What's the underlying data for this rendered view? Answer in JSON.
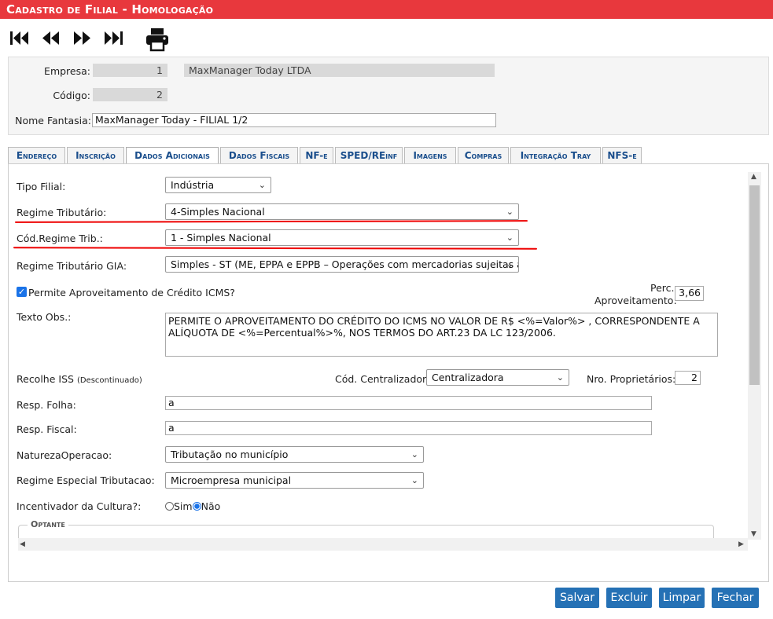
{
  "window": {
    "title": "Cadastro de Filial  - Homologação"
  },
  "toolbar": {
    "icons": [
      "first-record-icon",
      "previous-record-icon",
      "next-record-icon",
      "last-record-icon",
      "print-icon"
    ]
  },
  "header": {
    "empresa_label": "Empresa:",
    "empresa_code": "1",
    "empresa_name": "MaxManager Today LTDA",
    "codigo_label": "Código:",
    "codigo_value": "2",
    "nome_fantasia_label": "Nome Fantasia:",
    "nome_fantasia_value": "MaxManager Today - FILIAL 1/2"
  },
  "tabs": [
    {
      "label": "Endereço"
    },
    {
      "label": "Inscrição"
    },
    {
      "label": "Dados Adicionais"
    },
    {
      "label": "Dados Fiscais"
    },
    {
      "label": "NF-e"
    },
    {
      "label": "SPED/REinf"
    },
    {
      "label": "Imagens"
    },
    {
      "label": "Compras"
    },
    {
      "label": "Integração Tray"
    },
    {
      "label": "NFS-e"
    }
  ],
  "active_tab": "Dados Adicionais",
  "form": {
    "tipo_filial": {
      "label": "Tipo Filial:",
      "value": "Indústria"
    },
    "regime_tributario": {
      "label": "Regime Tributário:",
      "value": "4-Simples Nacional"
    },
    "cod_regime": {
      "label": "Cód.Regime Trib.:",
      "value": "1 - Simples Nacional"
    },
    "regime_gia": {
      "label": "Regime Tributário GIA:",
      "value": "Simples - ST (ME, EPPA e EPPB – Operações com mercadorias sujeitas à"
    },
    "permite_aproveitamento": {
      "label": "Permite Aproveitamento de Crédito ICMS?",
      "checked": true
    },
    "perc_aproveitamento": {
      "label_line1": "Perc.",
      "label_line2": "Aproveitamento:",
      "value": "3,66"
    },
    "texto_obs": {
      "label": "Texto Obs.:",
      "value": "PERMITE O APROVEITAMENTO DO CRÉDITO DO ICMS NO VALOR DE R$ <%=Valor%> , CORRESPONDENTE A ALÍQUOTA DE <%=Percentual%>%, NOS TERMOS DO ART.23 DA LC 123/2006."
    },
    "recolhe_iss": {
      "label": "Recolhe ISS",
      "note": "(Descontinuado)"
    },
    "cod_centralizador": {
      "label": "Cód. Centralizador:",
      "value": "Centralizadora"
    },
    "nro_proprietarios": {
      "label": "Nro. Proprietários:",
      "value": "2"
    },
    "resp_folha": {
      "label": "Resp. Folha:",
      "value": "a"
    },
    "resp_fiscal": {
      "label": "Resp. Fiscal:",
      "value": "a"
    },
    "natureza_operacao": {
      "label": "NaturezaOperacao:",
      "value": "Tributação no município"
    },
    "regime_especial": {
      "label": "Regime Especial Tributacao:",
      "value": "Microempresa municipal"
    },
    "incentivador": {
      "label": "Incentivador da Cultura?:",
      "option_sim": "Sim",
      "option_nao": "Não",
      "selected": "Não"
    },
    "optante_legend": "Optante"
  },
  "buttons": {
    "salvar": "Salvar",
    "excluir": "Excluir",
    "limpar": "Limpar",
    "fechar": "Fechar"
  },
  "colors": {
    "title_bar": "#e8383d",
    "button": "#2571b5",
    "tab_text": "#1a4e8c",
    "annotation_red": "#e00000"
  }
}
